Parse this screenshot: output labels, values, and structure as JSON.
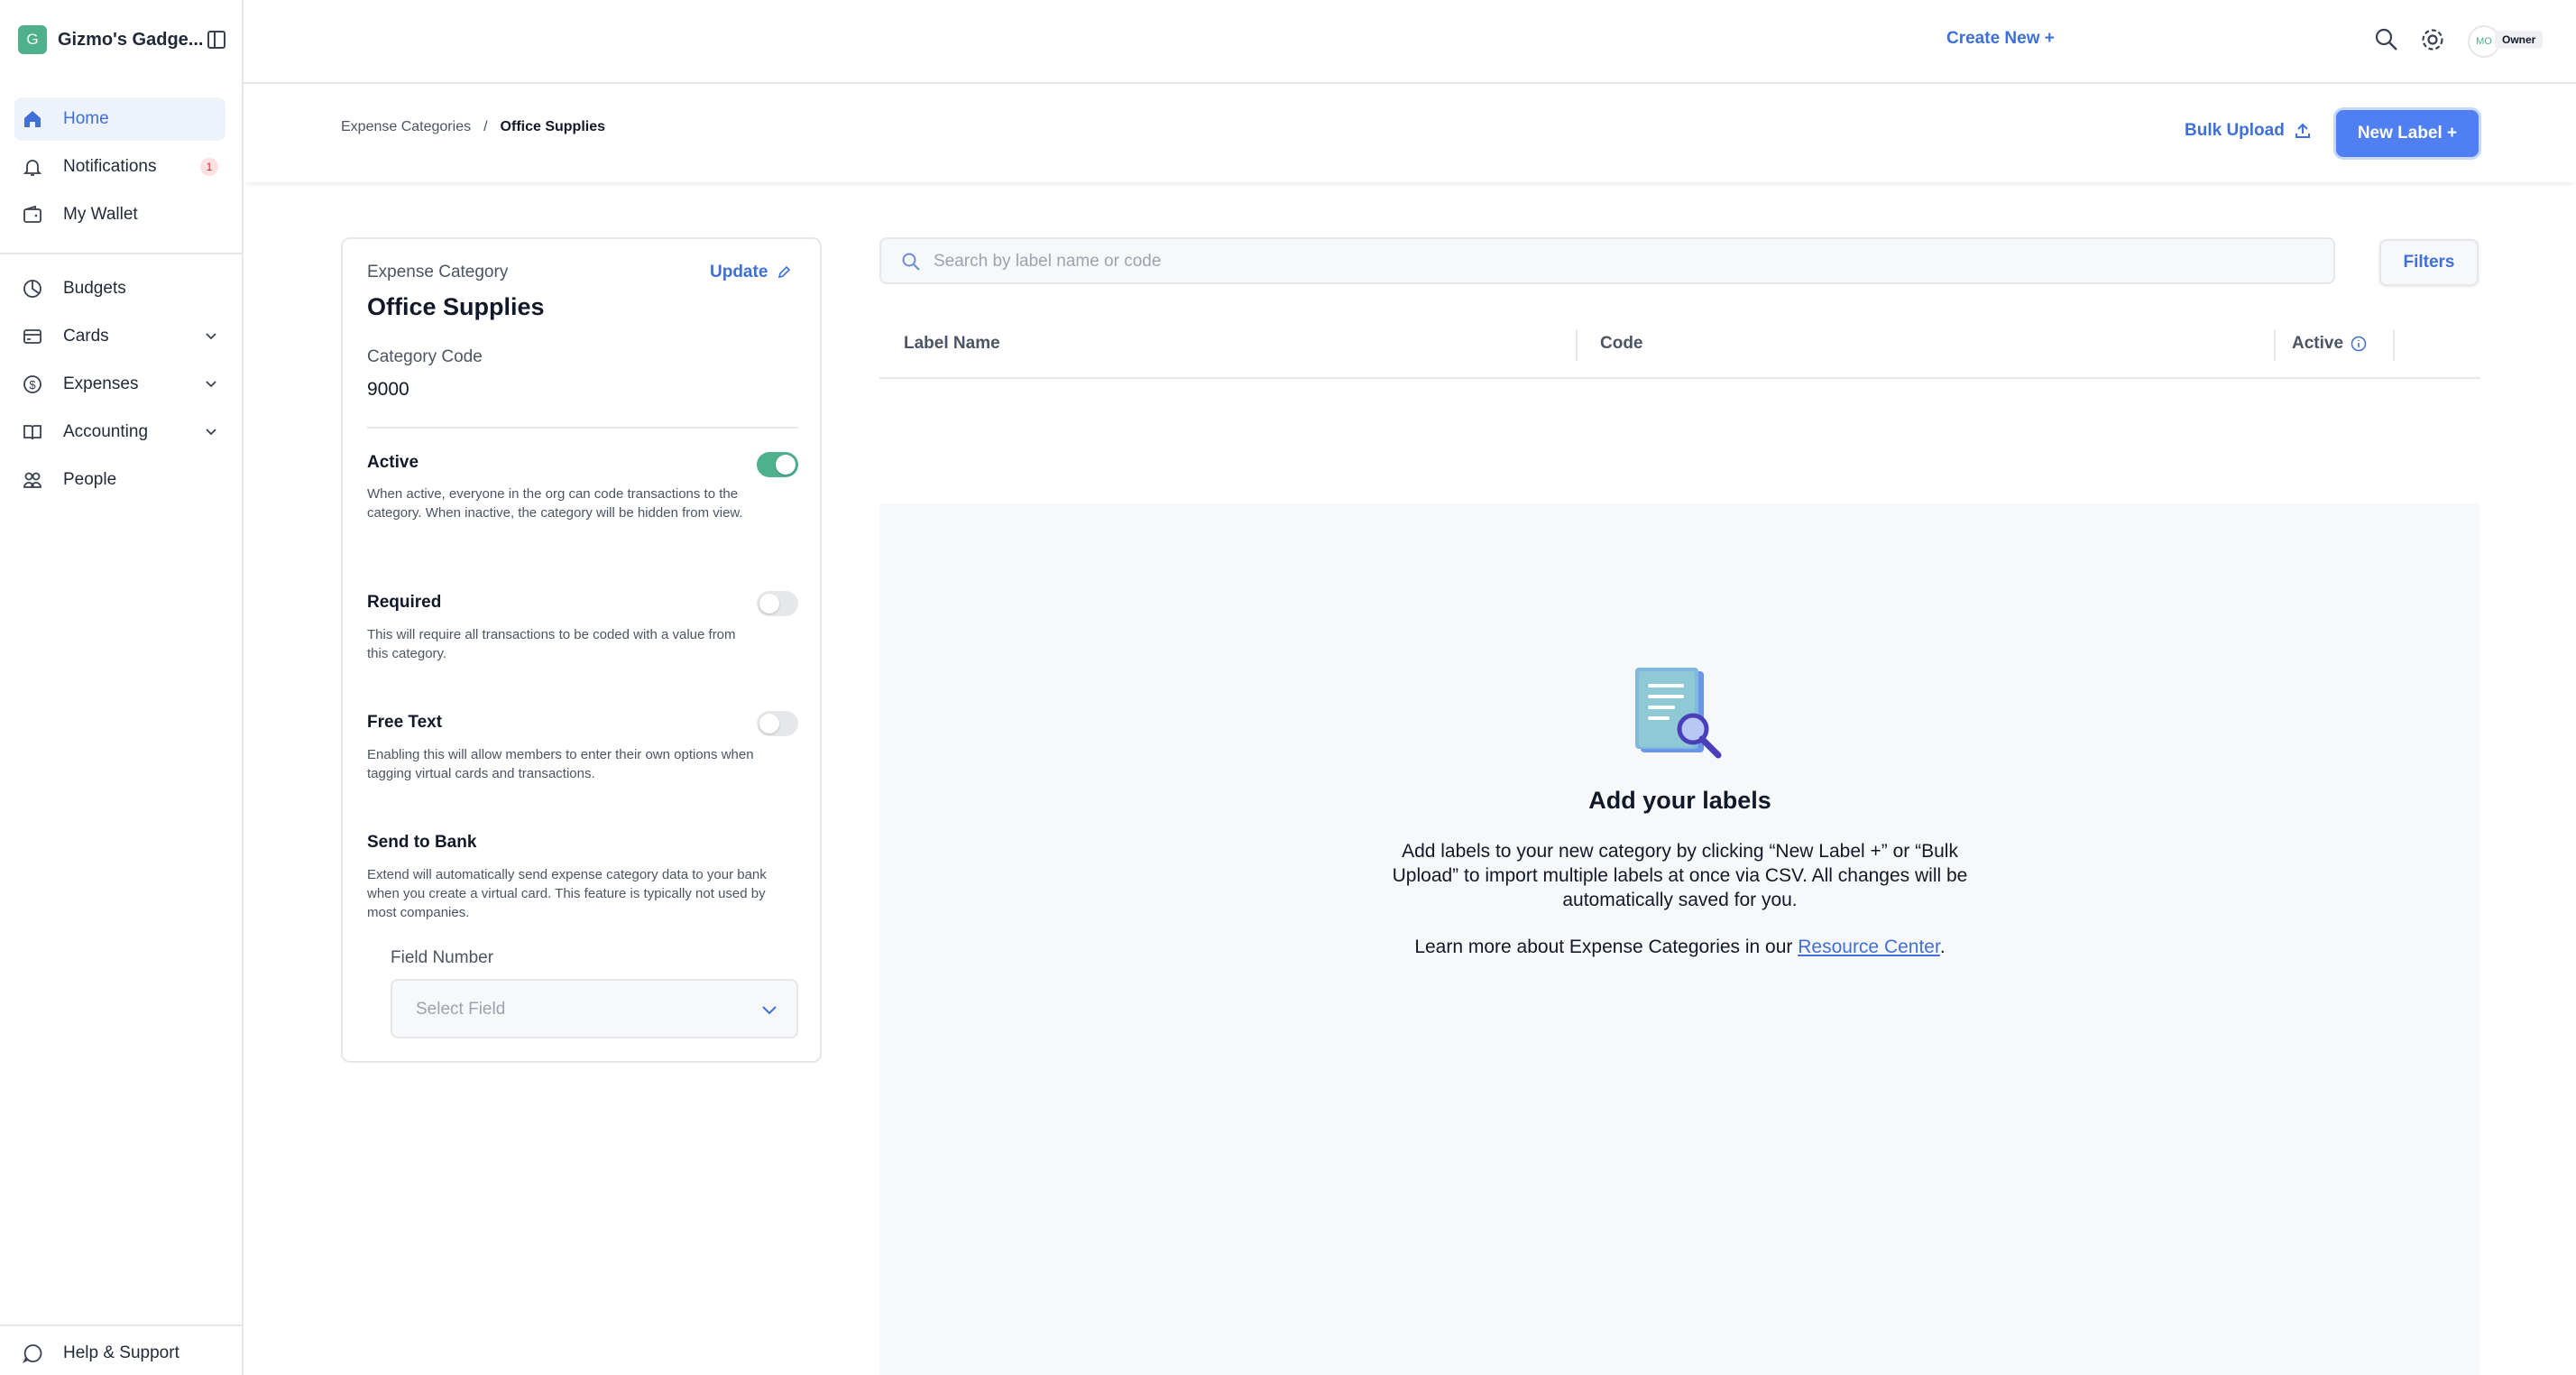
{
  "org": {
    "initial": "G",
    "name": "Gizmo's Gadge..."
  },
  "nav": {
    "items": [
      {
        "label": "Home",
        "icon": "home-icon"
      },
      {
        "label": "Notifications",
        "icon": "bell-icon",
        "badge": "1"
      },
      {
        "label": "My Wallet",
        "icon": "wallet-icon"
      },
      {
        "label": "Budgets",
        "icon": "pie-icon"
      },
      {
        "label": "Cards",
        "icon": "card-icon"
      },
      {
        "label": "Expenses",
        "icon": "dollar-circle-icon"
      },
      {
        "label": "Accounting",
        "icon": "book-icon"
      },
      {
        "label": "People",
        "icon": "people-icon"
      }
    ],
    "help": "Help & Support"
  },
  "topbar": {
    "create_new": "Create New +",
    "avatar_initials": "MO",
    "role": "Owner"
  },
  "breadcrumb": {
    "parent": "Expense Categories",
    "separator": "/",
    "current": "Office Supplies"
  },
  "actions": {
    "bulk_upload": "Bulk Upload",
    "new_label": "New Label +"
  },
  "category": {
    "type_label": "Expense Category",
    "name": "Office Supplies",
    "update": "Update",
    "code_label": "Category Code",
    "code": "9000",
    "active": {
      "title": "Active",
      "desc": "When active, everyone in the org can code transactions to the category. When inactive, the category will be hidden from view.",
      "on": true
    },
    "required": {
      "title": "Required",
      "desc": "This will require all transactions to be coded with a value from this category.",
      "on": false
    },
    "free_text": {
      "title": "Free Text",
      "desc": "Enabling this will allow members to enter their own options when tagging virtual cards and transactions.",
      "on": false
    },
    "send_to_bank": {
      "title": "Send to Bank",
      "desc": "Extend will automatically send expense category data to your bank when you create a virtual card. This feature is typically not used by most companies."
    },
    "field_number_label": "Field Number",
    "field_placeholder": "Select Field"
  },
  "search": {
    "placeholder": "Search by label name or code"
  },
  "filters": "Filters",
  "table": {
    "columns": [
      "Label Name",
      "Code",
      "Active"
    ]
  },
  "empty": {
    "title": "Add your labels",
    "text": "Add labels to your new category by clicking “New Label +” or “Bulk Upload” to import multiple labels at once via CSV. All changes will be automatically saved for you.",
    "learn_prefix": "Learn more about Expense Categories in our ",
    "link": "Resource Center",
    "learn_suffix": "."
  },
  "colors": {
    "accent": "#3f6fd8",
    "primary_button": "#4f7ff0",
    "toggle_on": "#4fb08c"
  }
}
